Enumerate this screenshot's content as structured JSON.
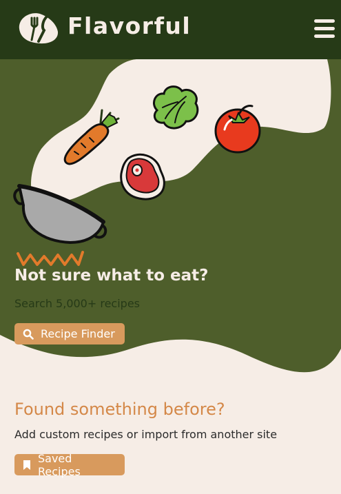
{
  "header": {
    "brand": "Flavorful",
    "logo_icon": "utensils-icon",
    "menu_icon": "hamburger-menu-icon"
  },
  "hero": {
    "title": "Not sure what to eat?",
    "subtitle": "Search 5,000+ recipes",
    "button_label": "Recipe Finder",
    "button_icon": "search-icon",
    "illustration": [
      "carrot-icon",
      "lettuce-icon",
      "tomato-icon",
      "steak-icon",
      "cooking-pot-icon",
      "fire-icon"
    ]
  },
  "saved": {
    "title": "Found something before?",
    "subtitle": "Add custom recipes or import from another site",
    "button_label": "Saved Recipes",
    "button_icon": "bookmark-icon"
  },
  "colors": {
    "header_bg": "#263a17",
    "hero_green": "#4e5e2b",
    "cream": "#f6ede6",
    "accent": "#d89a5d",
    "heading_accent": "#d48848"
  }
}
